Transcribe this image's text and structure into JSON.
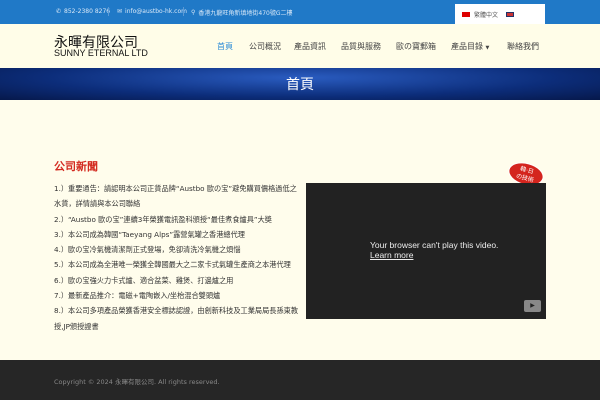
{
  "topbar": {
    "phone": "852-2380 8276",
    "email": "info@austbo-hk.com",
    "address": "香港九龍旺角新填地街470號G二樓"
  },
  "lang": {
    "current": "繁體中文",
    "alt": "EN"
  },
  "logo": {
    "cn": "永暉有限公司",
    "en": "SUNNY ETERNAL LTD"
  },
  "nav": [
    "首頁",
    "公司概況",
    "產品資訊",
    "品質與服務",
    "歐の寶郵箱",
    "產品目錄",
    "聯絡我們"
  ],
  "banner": {
    "title": "首頁"
  },
  "news": {
    "title": "公司新聞",
    "items": [
      "1.）重要通告：請認明本公司正貨品牌“Austbo 歐の宝”避免購買價格過低之水貨，詳情請與本公司聯絡",
      "2.）“Austbo 歐の宝”連續3年榮獲電訊盈科頒授“最佳煮食爐具”大獎",
      "3.）本公司成為韓國“Taeyang Alps”露營氣罐之香港總代理",
      "4.）歐の宝冷氣機清潔劑正式登場，免卻清洗冷氣機之煩惱",
      "5.）本公司成為全港唯一榮獲全韓國最大之二家卡式氣罐生產商之本港代理",
      "6.）歐の宝強火力卡式爐、適合盆菜、雞煲、打邊爐之用",
      "7.）最新產品推介：電磁+電陶嵌入/坐枱混合雙頭爐",
      "8.）本公司多項產品榮獲香港安全標誌認證，由創新科技及工業局局長孫東教授,JP頒授證書"
    ]
  },
  "badge": {
    "line1": "韓·日",
    "line2": "の技術"
  },
  "video": {
    "message": "Your browser can't play this video.",
    "link": "Learn more"
  },
  "footer": {
    "copyright": "Copyright © 2024 永暉有限公司. All rights reserved."
  }
}
